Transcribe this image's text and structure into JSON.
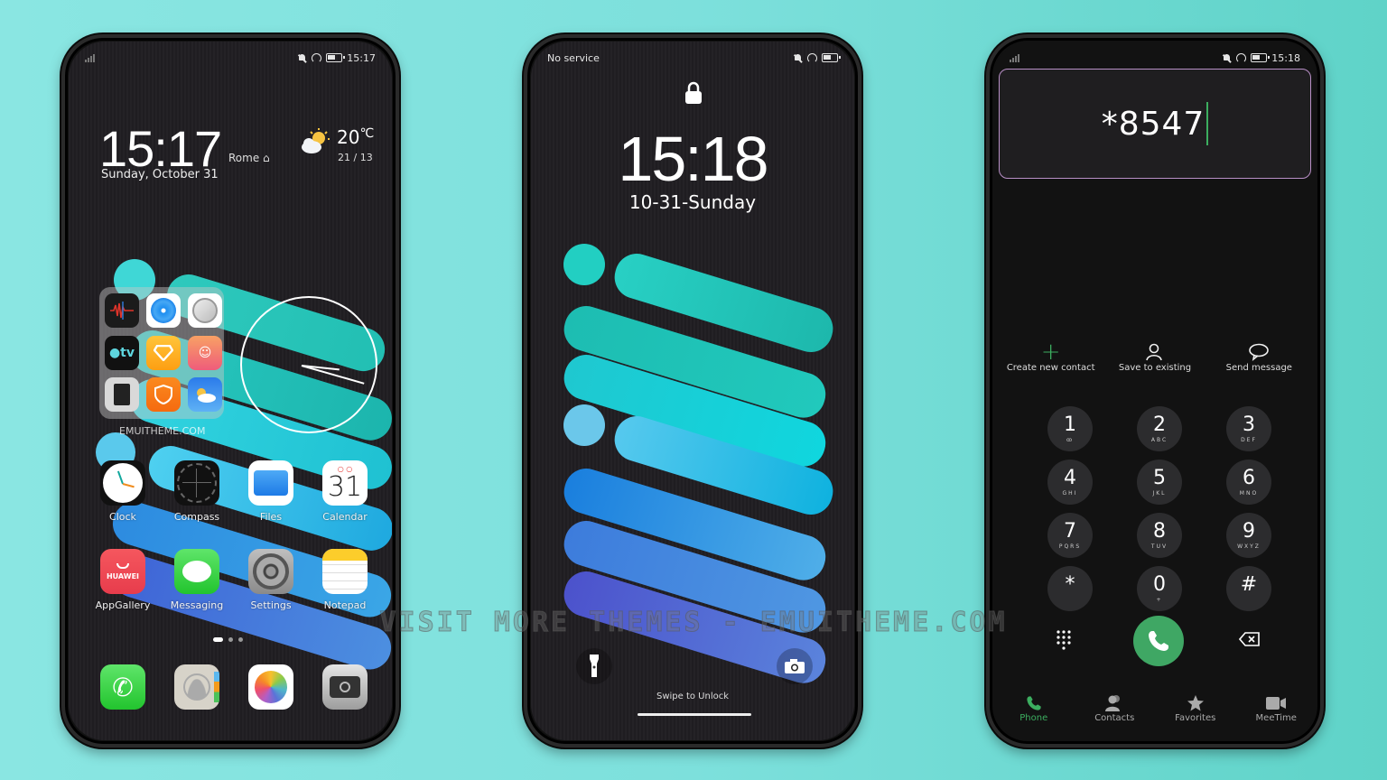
{
  "colors": {
    "background_left": "#8ae6e2",
    "background_right": "#5fd3c8",
    "accent_green": "#3cae60",
    "call_button": "#3fa764",
    "dial_box_border": "#b88fc6"
  },
  "home_screen": {
    "status": {
      "time": "15:17",
      "icons": [
        "signal-icon",
        "bell-off-icon",
        "speed-icon",
        "battery-icon"
      ]
    },
    "clock_widget": {
      "time": "15:17",
      "city": "Rome",
      "date": "Sunday, October 31"
    },
    "weather_widget": {
      "temp": "20",
      "unit": "℃",
      "range": "21 / 13",
      "icon": "partly-cloudy-icon"
    },
    "folder": {
      "apps": [
        "Voice Recorder",
        "Music",
        "Compass Mini",
        "Apple TV",
        "Themes",
        "Video Call",
        "Calculator",
        "Security",
        "Weather"
      ],
      "label": "EMUITHEME.COM"
    },
    "apps_row1": [
      {
        "label": "Clock",
        "icon": "clock-icon"
      },
      {
        "label": "Compass",
        "icon": "compass-icon"
      },
      {
        "label": "Files",
        "icon": "folder-icon"
      },
      {
        "label": "Calendar",
        "icon": "calendar-icon",
        "day": "31"
      }
    ],
    "apps_row2": [
      {
        "label": "AppGallery",
        "icon": "huawei-appgallery-icon",
        "brand": "HUAWEI"
      },
      {
        "label": "Messaging",
        "icon": "message-icon"
      },
      {
        "label": "Settings",
        "icon": "gear-icon"
      },
      {
        "label": "Notepad",
        "icon": "notepad-icon"
      }
    ],
    "pages": {
      "count": 3,
      "active": 1
    },
    "dock": [
      "phone-icon",
      "contacts-icon",
      "photos-icon",
      "camera-icon"
    ]
  },
  "lock_screen": {
    "status": {
      "carrier": "No service"
    },
    "time": "15:18",
    "date": "10-31-Sunday",
    "swipe_text": "Swipe to Unlock"
  },
  "dialer": {
    "status": {
      "time": "15:18"
    },
    "number": "*8547",
    "actions": [
      {
        "label": "Create new contact",
        "icon": "plus-icon"
      },
      {
        "label": "Save to existing",
        "icon": "person-icon"
      },
      {
        "label": "Send message",
        "icon": "chat-bubble-icon"
      }
    ],
    "keys": [
      {
        "digit": "1",
        "letters": "ꝏ"
      },
      {
        "digit": "2",
        "letters": "ABC"
      },
      {
        "digit": "3",
        "letters": "DEF"
      },
      {
        "digit": "4",
        "letters": "GHI"
      },
      {
        "digit": "5",
        "letters": "JKL"
      },
      {
        "digit": "6",
        "letters": "MNO"
      },
      {
        "digit": "7",
        "letters": "PQRS"
      },
      {
        "digit": "8",
        "letters": "TUV"
      },
      {
        "digit": "9",
        "letters": "WXYZ"
      },
      {
        "digit": "*",
        "letters": ""
      },
      {
        "digit": "0",
        "letters": "+"
      },
      {
        "digit": "#",
        "letters": ""
      }
    ],
    "tabs": [
      {
        "label": "Phone",
        "active": true
      },
      {
        "label": "Contacts",
        "active": false
      },
      {
        "label": "Favorites",
        "active": false
      },
      {
        "label": "MeeTime",
        "active": false
      }
    ]
  },
  "banner": "VISIT MORE THEMES - EMUITHEME.COM"
}
